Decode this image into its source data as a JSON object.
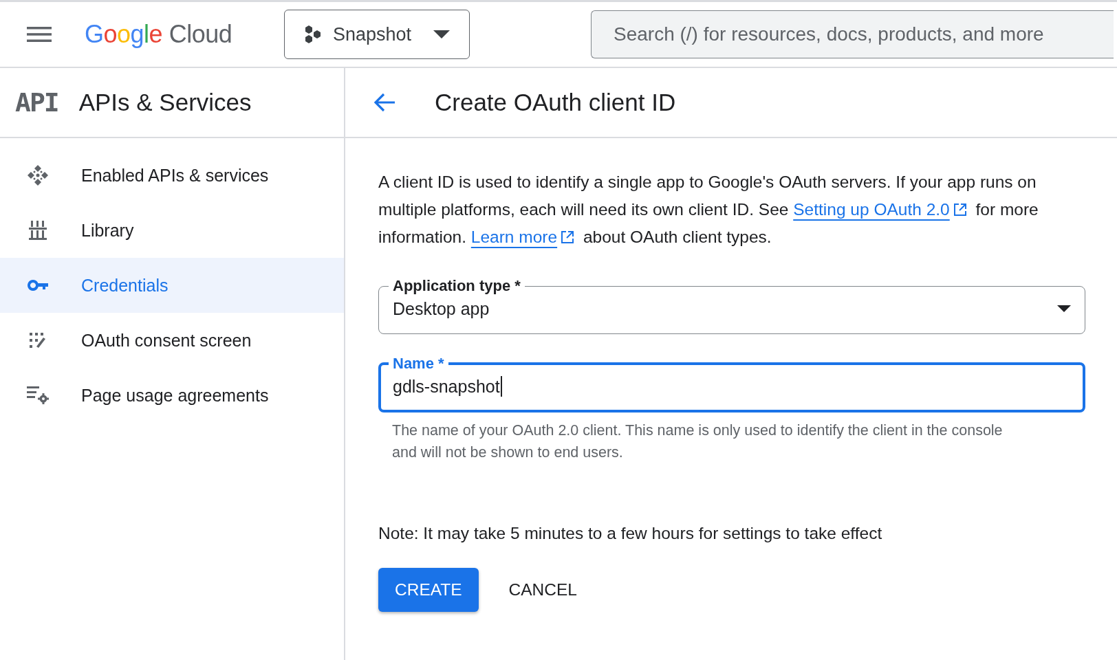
{
  "top_bar": {
    "logo": {
      "brand": "Google",
      "product": "Cloud"
    },
    "project": {
      "label": "Snapshot"
    },
    "search": {
      "placeholder": "Search (/) for resources, docs, products, and more"
    }
  },
  "sidebar": {
    "logo_text": "API",
    "title": "APIs & Services",
    "items": [
      {
        "label": "Enabled APIs & services",
        "kind": "apis",
        "selected": false
      },
      {
        "label": "Library",
        "kind": "library",
        "selected": false
      },
      {
        "label": "Credentials",
        "kind": "credentials",
        "selected": true
      },
      {
        "label": "OAuth consent screen",
        "kind": "consent",
        "selected": false
      },
      {
        "label": "Page usage agreements",
        "kind": "agreements",
        "selected": false
      }
    ]
  },
  "page": {
    "title": "Create OAuth client ID",
    "description": [
      {
        "kind": "text",
        "text": "A client ID is used to identify a single app to Google's OAuth servers. If your app runs on multiple platforms, each will need its own client ID. See "
      },
      {
        "kind": "link",
        "text": "Setting up OAuth 2.0"
      },
      {
        "kind": "text",
        "text": " for more information. "
      },
      {
        "kind": "link",
        "text": "Learn more"
      },
      {
        "kind": "text",
        "text": " about OAuth client types."
      }
    ],
    "application_type": {
      "label": "Application type *",
      "value": "Desktop app"
    },
    "name": {
      "label": "Name *",
      "value": "gdls-snapshot",
      "focused": true,
      "helper": "The name of your OAuth 2.0 client. This name is only used to identify the client in the console and will not be shown to end users."
    },
    "note": "Note: It may take 5 minutes to a few hours for settings to take effect",
    "buttons": [
      {
        "label": "CREATE",
        "kind": "primary"
      },
      {
        "label": "CANCEL",
        "kind": "text"
      }
    ]
  }
}
